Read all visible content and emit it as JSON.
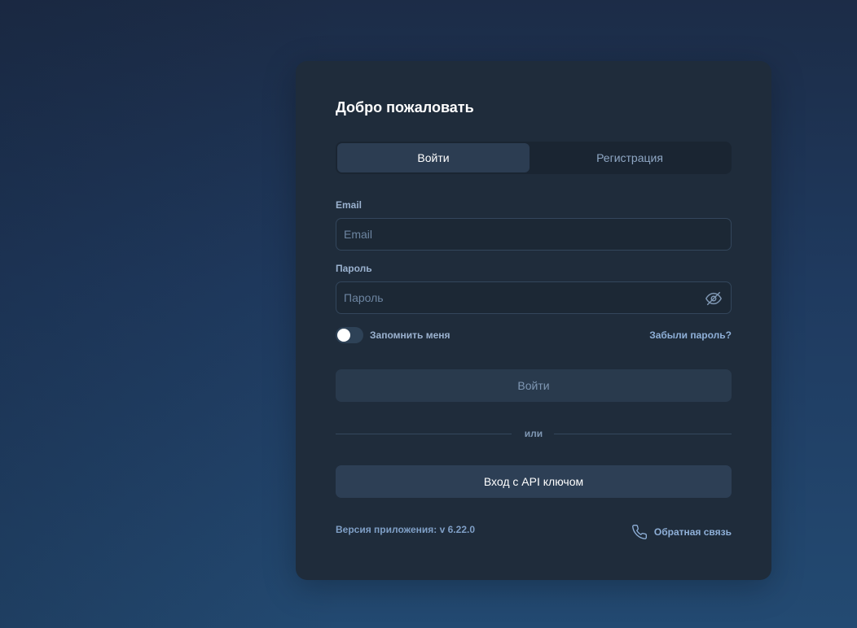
{
  "login_card": {
    "title": "Добро пожаловать",
    "tabs": [
      {
        "label": "Войти",
        "active": true
      },
      {
        "label": "Регистрация",
        "active": false
      }
    ],
    "email": {
      "label": "Email",
      "placeholder": "Email",
      "value": ""
    },
    "password": {
      "label": "Пароль",
      "placeholder": "Пароль",
      "value": "",
      "visibility_icon": "eye-off-icon"
    },
    "remember_me": {
      "label": "Запомнить меня",
      "checked": false
    },
    "forgot_password": "Забыли пароль?",
    "login_button": "Войти",
    "divider_text": "или",
    "api_key_button": "Вход с API ключом",
    "version": "Версия приложения: v 6.22.0",
    "feedback": {
      "label": "Обратная связь",
      "icon": "phone-icon"
    }
  },
  "colors": {
    "background_top": "#1c2c47",
    "background_bottom": "#234a72",
    "card": "#1f2c3b",
    "accent_link": "#8fb0d8",
    "text_primary": "#ffffff"
  }
}
